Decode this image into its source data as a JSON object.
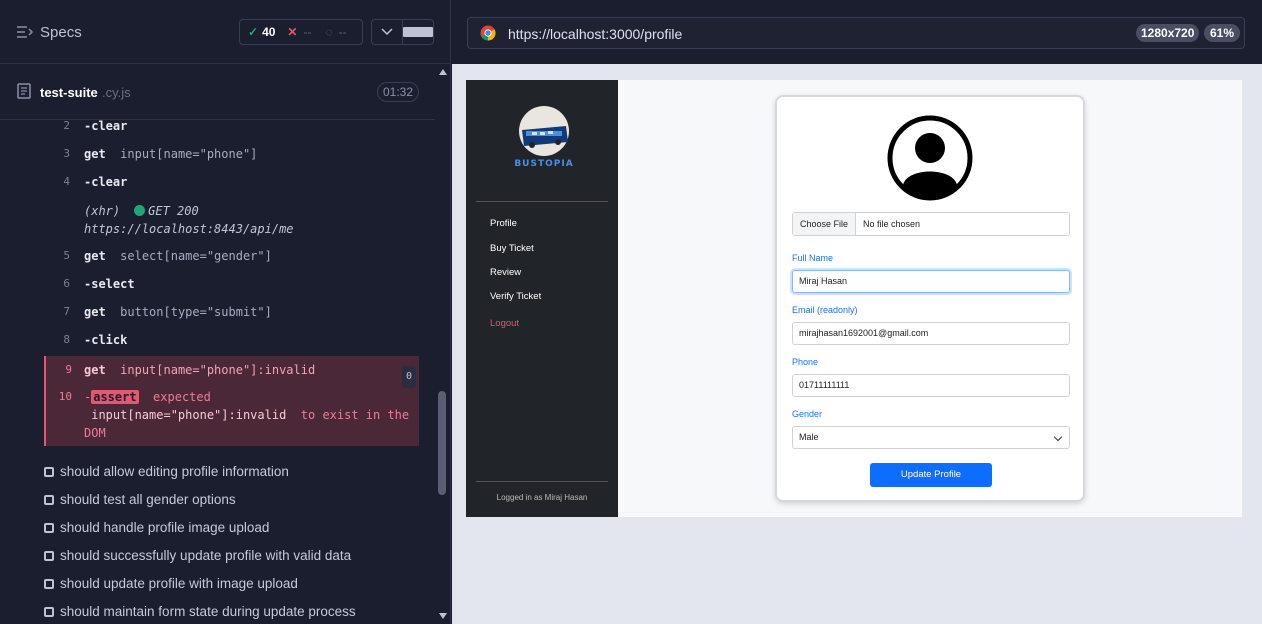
{
  "reporter": {
    "specs_label": "Specs",
    "passed_count": "40",
    "failed_count": "--",
    "pending_count": "--",
    "suite_name": "test-suite",
    "suite_ext": ".cy.js",
    "timer": "01:32"
  },
  "commands": [
    {
      "num": "2",
      "name": "-clear",
      "arg": ""
    },
    {
      "num": "3",
      "name": "get",
      "arg": "input[name=\"phone\"]"
    },
    {
      "num": "4",
      "name": "-clear",
      "arg": ""
    },
    {
      "num": "5",
      "name": "get",
      "arg": "select[name=\"gender\"]"
    },
    {
      "num": "6",
      "name": "-select",
      "arg": ""
    },
    {
      "num": "7",
      "name": "get",
      "arg": "button[type=\"submit\"]"
    },
    {
      "num": "8",
      "name": "-click",
      "arg": ""
    }
  ],
  "xhr": {
    "label": "(xhr)",
    "status": "GET 200",
    "url": "https://localhost:8443/api/me"
  },
  "error": {
    "num9": "9",
    "cmd9_name": "get",
    "cmd9_arg": "input[name=\"phone\"]:invalid",
    "count": "0",
    "num10": "10",
    "dash": "-",
    "assert_label": "assert",
    "expected": "expected",
    "selector": "input[name=\"phone\"]:invalid",
    "tail": "to exist in the DOM"
  },
  "tests": [
    "should allow editing profile information",
    "should test all gender options",
    "should handle profile image upload",
    "should successfully update profile with valid data",
    "should update profile with image upload",
    "should maintain form state during update process"
  ],
  "browser": {
    "url": "https://localhost:3000/profile",
    "resolution": "1280x720",
    "zoom": "61%"
  },
  "app": {
    "nav": [
      "Profile",
      "Buy Ticket",
      "Review",
      "Verify Ticket"
    ],
    "logout": "Logout",
    "logged_in": "Logged in as Miraj Hasan",
    "logo_text": "BUSTOPIA",
    "file_button": "Choose File",
    "file_status": "No file chosen",
    "full_name_label": "Full Name",
    "full_name_value": "Miraj Hasan",
    "email_label": "Email (readonly)",
    "email_value": "mirajhasan1692001@gmail.com",
    "phone_label": "Phone",
    "phone_value": "01711111111",
    "gender_label": "Gender",
    "gender_value": "Male",
    "submit_label": "Update Profile"
  },
  "colors": {
    "pass": "#1fa971",
    "fail": "#e45770",
    "primary": "#0d6efd"
  }
}
